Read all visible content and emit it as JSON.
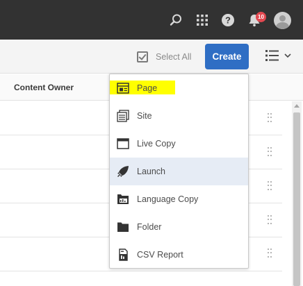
{
  "topbar": {
    "icons": [
      "search-icon",
      "apps-grid-icon",
      "help-icon",
      "bell-icon"
    ],
    "notification_count": "10",
    "colors": {
      "bar": "#323232",
      "badge": "#e34850"
    }
  },
  "actionbar": {
    "select_all_label": "Select All",
    "create_label": "Create",
    "colors": {
      "create": "#2f6ec4"
    }
  },
  "table": {
    "column_header": "Content Owner",
    "row_count": 5
  },
  "create_menu": {
    "items": [
      {
        "label": "Page",
        "icon": "page-icon",
        "highlighted": true
      },
      {
        "label": "Site",
        "icon": "site-icon"
      },
      {
        "label": "Live Copy",
        "icon": "live-copy-icon"
      },
      {
        "label": "Launch",
        "icon": "launch-icon",
        "hovered": true
      },
      {
        "label": "Language Copy",
        "icon": "language-copy-icon"
      },
      {
        "label": "Folder",
        "icon": "folder-icon"
      },
      {
        "label": "CSV Report",
        "icon": "csv-report-icon"
      }
    ],
    "colors": {
      "highlight": "#ffff00",
      "hover": "#e6ecf5"
    }
  }
}
